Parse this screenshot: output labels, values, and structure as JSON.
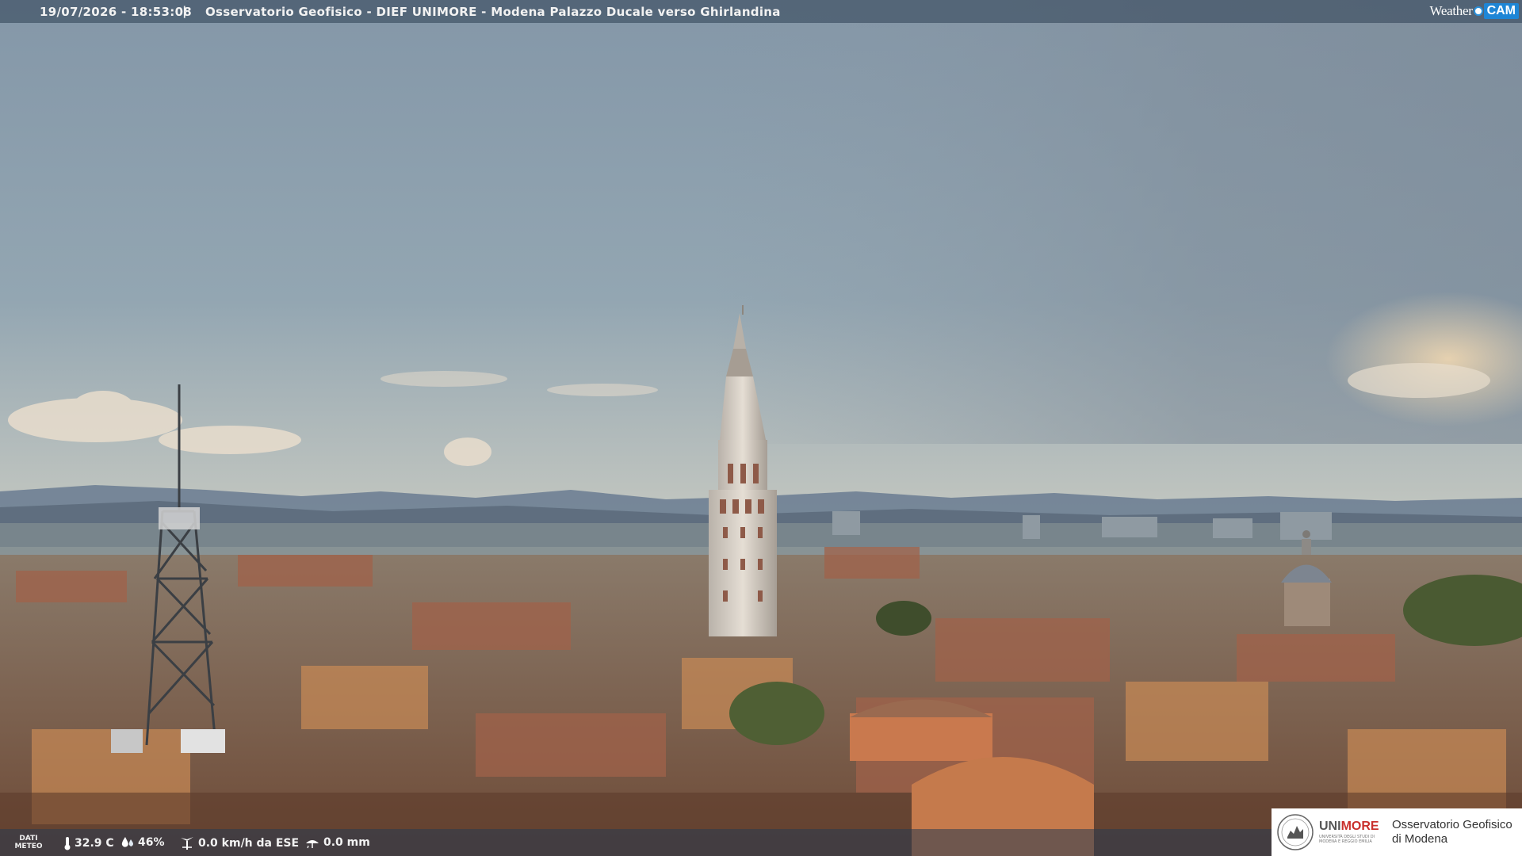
{
  "header": {
    "timestamp": "19/07/2026 - 18:53:08",
    "separator": "|",
    "title": "Osservatorio Geofisico - DIEF UNIMORE - Modena Palazzo Ducale verso Ghirlandina"
  },
  "brand": {
    "weather": "Weather",
    "cam": "CAM"
  },
  "weather_bar": {
    "label_line1": "DATI",
    "label_line2": "METEO",
    "temperature": "32.9 C",
    "humidity": "46%",
    "wind": "0.0 km/h da ESE",
    "rain": "0.0 mm",
    "icons": [
      "thermometer-icon",
      "humidity-icon",
      "wind-icon",
      "rain-icon"
    ]
  },
  "institution": {
    "uni_a": "UNI",
    "uni_b": "MORE",
    "uni_sub": "UNIVERSITÀ DEGLI STUDI DI MODENA E REGGIO EMILIA",
    "obs_line1": "Osservatorio Geofisico",
    "obs_line2": "di Modena"
  },
  "colors": {
    "accent_red": "#c9302c",
    "brand_blue": "#1e86d6"
  }
}
